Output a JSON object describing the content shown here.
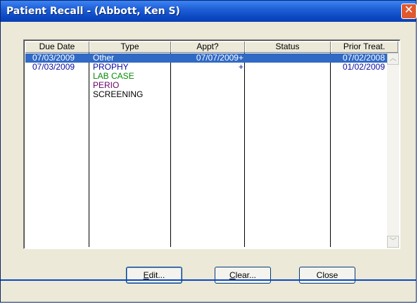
{
  "window": {
    "title": "Patient Recall - (Abbott, Ken S)",
    "close_glyph": "✕"
  },
  "columns": [
    "Due Date",
    "Type",
    "Appt?",
    "Status",
    "Prior Treat."
  ],
  "rows": [
    {
      "due_date": "07/03/2009",
      "type": "Other",
      "appt": "07/07/2009+",
      "status": "",
      "prior": "07/02/2008"
    },
    {
      "due_date": "07/03/2009",
      "type": "PROPHY",
      "appt": "+",
      "status": "",
      "prior": "01/02/2009"
    }
  ],
  "type_lines": [
    {
      "text": "LAB CASE",
      "color": "#0a8a0a"
    },
    {
      "text": "PERIO",
      "color": "#6a006a"
    },
    {
      "text": "SCREENING",
      "color": "#000000"
    }
  ],
  "colors": {
    "row_text": "#0a0aa0",
    "selection": "#316ac5"
  },
  "buttons": {
    "edit": {
      "mnemonic": "E",
      "rest": "dit..."
    },
    "clear": {
      "mnemonic": "C",
      "rest": "lear..."
    },
    "close": {
      "label": "Close"
    }
  },
  "scrollbar": {
    "up_glyph": "︿",
    "down_glyph": "﹀"
  }
}
